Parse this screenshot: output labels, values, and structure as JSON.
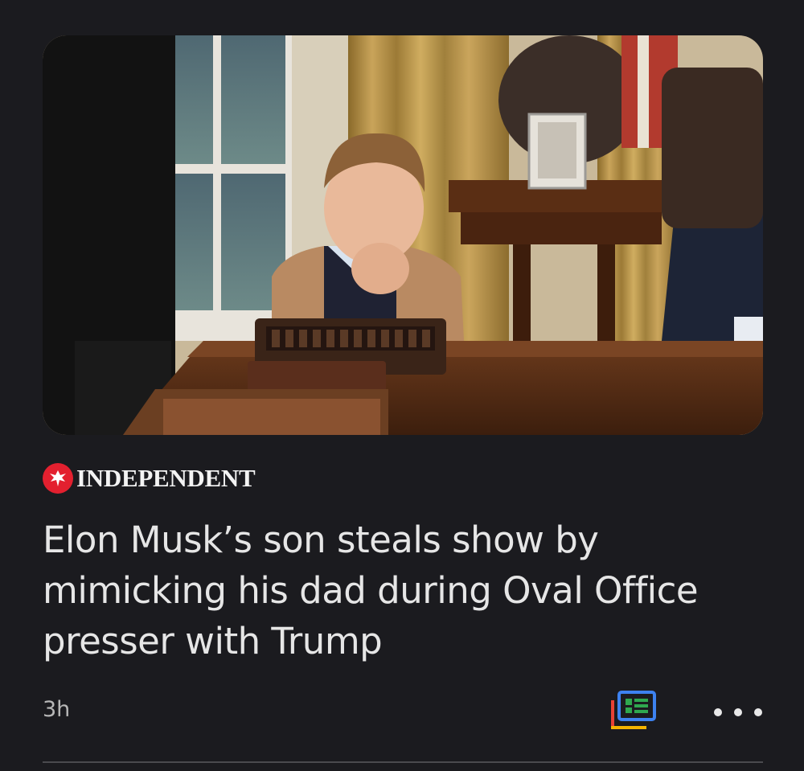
{
  "article": {
    "image": {
      "alt": "Elon Musk's son in the Oval Office"
    },
    "source": {
      "name": "INDEPENDENT",
      "logo_icon": "eagle-icon",
      "logo_color": "#e3202f"
    },
    "headline": "Elon Musk’s son steals show by mimicking his dad during Oval Office presser with Trump",
    "time": "3h",
    "actions": {
      "full_coverage_icon": "full-coverage-icon",
      "more_icon": "more-horizontal-icon"
    }
  },
  "colors": {
    "background": "#1b1b1f",
    "headline_text": "#e6e6e6",
    "meta_text": "#b7b7b7"
  }
}
